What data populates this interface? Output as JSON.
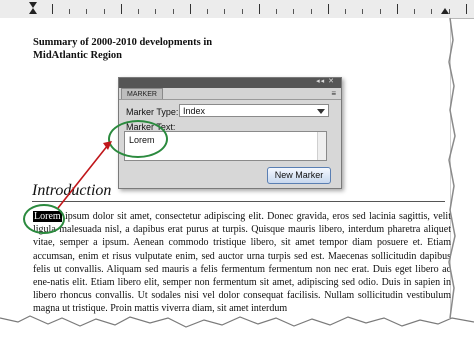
{
  "document": {
    "title_line1": "Summary of 2000-2010 developments in",
    "title_line2": "MidAtlantic Region",
    "heading": "Introduction",
    "highlighted_word": "Lorem",
    "body_after_highlight": " ipsum dolor sit amet, consectetur adipiscing elit. Donec gravida, eros sed lacinia sagittis, velit ligula malesuada nisl, a dapibus erat purus at turpis. Quisque mauris libero, interdum pharetra aliquet vitae, semper a ipsum. Aenean commodo tristique libero, sit amet tempor diam posuere et. Etiam accumsan, enim et risus vulputate enim, sed auctor urna turpis sed est. Maecenas sollicitudin dapibus felis ut convallis. Aliquam sed mauris a felis fermentum fermentum non nec erat. Duis eget libero ac ene-natis elit. Etiam libero elit, semper non fermentum sit amet, adipiscing sed odio. Duis in sapien in libero rhoncus convallis. Ut sodales nisi vel dolor consequat facilisis. Nullam sollicitudin vestibulum magna ut tristique. Proin mattis viverra diam, sit amet interdum"
  },
  "marker_panel": {
    "tab_label": "MARKER",
    "window_controls": "◂◂ ✕",
    "menu_icon": "≡",
    "marker_type_label": "Marker Type:",
    "marker_type_value": "Index",
    "marker_text_label": "Marker Text:",
    "marker_text_value": "Lorem",
    "new_marker_button": "New Marker"
  },
  "colors": {
    "annotation_green": "#2b8a3e",
    "annotation_red": "#c0161a"
  }
}
